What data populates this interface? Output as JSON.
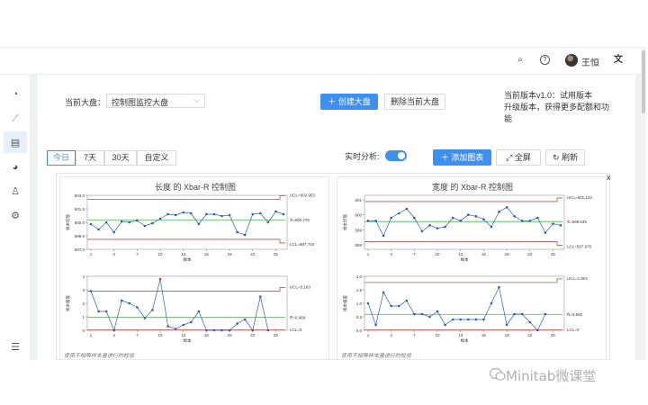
{
  "topbar": {
    "search_icon": "search-icon",
    "help_icon": "help-icon",
    "username": "王恒",
    "translate_icon": "translate-icon"
  },
  "sidebar": {
    "items": [
      {
        "icon": "dashboard-icon",
        "glyph": "◔"
      },
      {
        "icon": "trend-icon",
        "glyph": "⟋",
        "active": true
      },
      {
        "icon": "table-icon",
        "glyph": "▤"
      },
      {
        "icon": "pie-icon",
        "glyph": "◕"
      },
      {
        "icon": "user-icon",
        "glyph": "♙"
      },
      {
        "icon": "settings-icon",
        "glyph": "⚙"
      }
    ],
    "collapse_glyph": "☰"
  },
  "toolbar": {
    "board_label": "当前大盘：",
    "board_value": "控制图监控大盘",
    "create_label": "创建大盘",
    "delete_label": "删除当前大盘",
    "version_text": "当前版本v1.0：试用版本",
    "upgrade_text": "升级版本，获得更多配额和功能"
  },
  "filters": {
    "ranges": [
      "今日",
      "7天",
      "30天",
      "自定义"
    ],
    "active_range": "今日",
    "realtime_label": "实时分析:",
    "add_chart_label": "添加图表",
    "fullscreen_label": "全屏",
    "refresh_label": "刷新",
    "close_glyph": "x"
  },
  "footnote": "使用不相等样本量进行的检验",
  "chart_data": [
    {
      "type": "line",
      "title": "长度 的 Xbar-R 控制图",
      "panel": "xbar",
      "xlabel": "样本",
      "ylabel": "样本均值",
      "x_ticks": [
        1,
        4,
        7,
        10,
        13,
        16,
        19,
        22,
        25
      ],
      "y_ticks": [
        "603.0",
        "601.5",
        "600.0",
        "598.5",
        "597.0"
      ],
      "ylim": [
        597.0,
        603.0
      ],
      "ucl": 602.953,
      "center": 600.276,
      "lcl": 597.704,
      "ucl_label": "UCL=602.953",
      "center_label": "X̄=600.276",
      "lcl_label": "LCL=597.704",
      "values": [
        599.8,
        599.2,
        600.0,
        598.9,
        600.1,
        600.0,
        600.2,
        599.6,
        599.9,
        600.4,
        600.9,
        600.8,
        601.1,
        601.0,
        599.8,
        600.9,
        600.9,
        600.7,
        600.8,
        598.9,
        598.6,
        600.9,
        601.0,
        600.0,
        601.2,
        600.9
      ]
    },
    {
      "type": "line",
      "title": "长度 的 Xbar-R 控制图",
      "panel": "range",
      "xlabel": "样本",
      "ylabel": "样本极差",
      "x_ticks": [
        1,
        4,
        7,
        10,
        13,
        16,
        19,
        22,
        25
      ],
      "y_ticks": [
        "4",
        "3",
        "2",
        "1",
        "0"
      ],
      "ylim": [
        0,
        4
      ],
      "ucl": 3.163,
      "center": 0.968,
      "lcl": 0,
      "ucl_label": "UCL=3.163",
      "center_label": "R̄=0.968",
      "lcl_label": "LCL=0",
      "values": [
        2.9,
        1.4,
        1.4,
        0.0,
        2.2,
        2.0,
        1.7,
        0.9,
        1.5,
        3.8,
        0.3,
        0.1,
        0.4,
        0.6,
        1.4,
        0.0,
        0.0,
        0.0,
        0.0,
        0.5,
        0.8,
        0.0,
        2.5,
        0.0
      ]
    },
    {
      "type": "line",
      "title": "宽度 的 Xbar-R 控制图",
      "panel": "xbar",
      "xlabel": "样本",
      "ylabel": "样本均值",
      "x_ticks": [
        1,
        4,
        7,
        10,
        13,
        16,
        19,
        22,
        25
      ],
      "y_ticks": [
        "601",
        "600",
        "599",
        "598"
      ],
      "ylim": [
        597.7,
        601.3
      ],
      "ucl": 601.123,
      "center": 599.549,
      "lcl": 597.975,
      "ucl_label": "UCL=601.123",
      "center_label": "X̄=599.549",
      "lcl_label": "LCL=597.975",
      "values": [
        599.6,
        599.6,
        598.6,
        599.8,
        600.1,
        600.4,
        599.8,
        598.9,
        599.3,
        599.1,
        599.2,
        599.8,
        599.6,
        600.0,
        599.9,
        599.7,
        599.2,
        600.2,
        600.5,
        599.9,
        599.6,
        599.6,
        599.8,
        598.8,
        599.4,
        599.3
      ]
    },
    {
      "type": "line",
      "title": "宽度 的 Xbar-R 控制图",
      "panel": "range",
      "xlabel": "样本",
      "ylabel": "样本极差",
      "x_ticks": [
        1,
        4,
        7,
        10,
        13,
        16,
        19,
        22,
        25
      ],
      "y_ticks": [
        "2.0",
        "1.5",
        "1.0",
        "0.5",
        "0.0"
      ],
      "ylim": [
        0,
        2
      ],
      "ucl": 1.904,
      "center": 0.592,
      "lcl": 0,
      "ucl_label": "UCL=1.904",
      "center_label": "R̄=0.592",
      "lcl_label": "LCL=0",
      "values": [
        1.0,
        0.2,
        1.4,
        0.9,
        0.9,
        1.1,
        0.6,
        0.6,
        0.5,
        0.7,
        0.2,
        0.4,
        0.4,
        0.4,
        0.4,
        0.4,
        1.0,
        1.6,
        0.2,
        0.6,
        0.6,
        0.3,
        0.0,
        0.6
      ]
    }
  ],
  "colors": {
    "accent": "#3d8ff0",
    "ucl_line": "#c0504d",
    "center_line": "#4caf50",
    "series": "#2e5fa8",
    "out_of_control": "#d32f2f"
  },
  "watermark": "Minitab微课堂"
}
